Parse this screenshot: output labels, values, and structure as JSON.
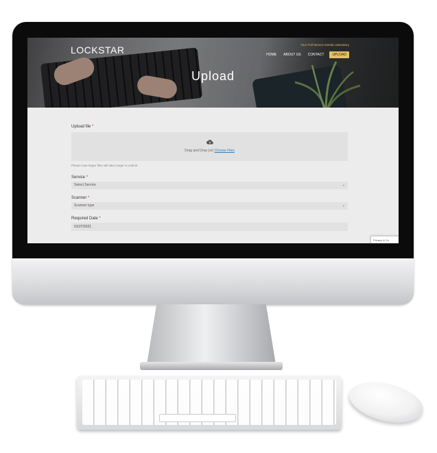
{
  "site": {
    "logo": "LOCKSTAR",
    "tagline": "Your Full Service Dental Laboratory",
    "nav": [
      "HOME",
      "ABOUT US",
      "CONTACT",
      "UPLOAD"
    ],
    "active_nav": "UPLOAD",
    "page_title": "Upload"
  },
  "form": {
    "upload_label": "Upload file",
    "required_mark": "*",
    "dropzone_text": "Drag and Drop (or)",
    "dropzone_link": "Choose Files",
    "note": "Please note larger files will take longer to submit",
    "service_label": "Service",
    "service_value": "Select Service",
    "scanner_label": "Scanner",
    "scanner_value": "Scanner type",
    "date_label": "Required Date",
    "date_value": "01/27/2021"
  },
  "recaptcha_badge": "Privacy & Co",
  "icons": {
    "upload": "cloud-upload-icon",
    "chevron": "chevron-down-icon"
  },
  "colors": {
    "accent": "#e3c162",
    "link": "#2d7fc1",
    "required": "#c0392b"
  }
}
